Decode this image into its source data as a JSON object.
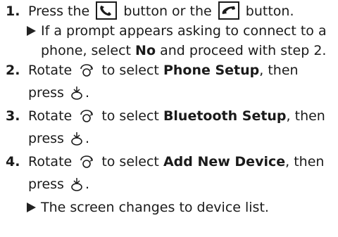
{
  "steps": [
    {
      "number": "1.",
      "text_a": "Press the",
      "text_b": "button or the",
      "text_c": "button.",
      "icons": [
        "phone-pickup-icon",
        "phone-hangup-icon"
      ],
      "sub": {
        "text_a": "If a prompt appears asking to connect to a phone, select",
        "bold": "No",
        "text_b": "and proceed with step 2."
      }
    },
    {
      "number": "2.",
      "text_a": "Rotate",
      "text_b": "to select",
      "bold": "Phone Setup",
      "text_c": ", then press",
      "text_d": ".",
      "icons": [
        "interface-dial-rotate-icon",
        "interface-dial-press-icon"
      ]
    },
    {
      "number": "3.",
      "text_a": "Rotate",
      "text_b": "to select",
      "bold": "Bluetooth Setup",
      "text_c": ", then press",
      "text_d": ".",
      "icons": [
        "interface-dial-rotate-icon",
        "interface-dial-press-icon"
      ]
    },
    {
      "number": "4.",
      "text_a": "Rotate",
      "text_b": "to select",
      "bold": "Add New Device",
      "text_c": ", then press",
      "text_d": ".",
      "icons": [
        "interface-dial-rotate-icon",
        "interface-dial-press-icon"
      ],
      "sub": {
        "text_a": "The screen changes to device list."
      }
    }
  ]
}
